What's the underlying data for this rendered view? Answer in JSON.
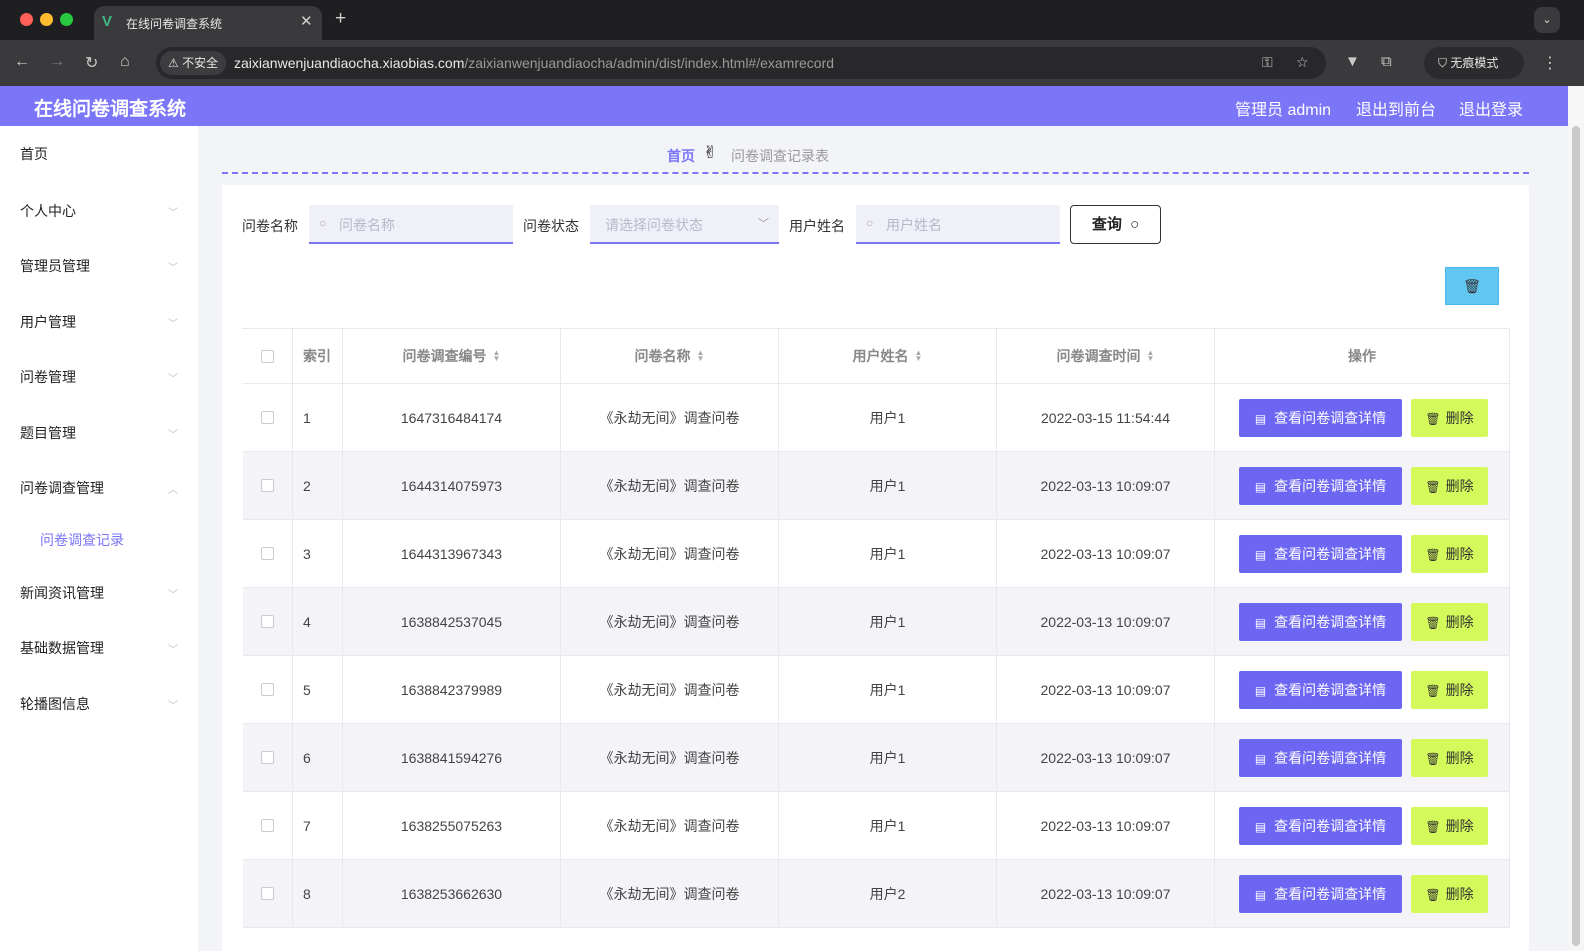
{
  "browser": {
    "tab_title": "在线问卷调查系统",
    "insecure_label": "不安全",
    "url_host": "zaixianwenjuandiaocha.xiaobias.com",
    "url_path": "/zaixianwenjuandiaocha/admin/dist/index.html#/examrecord",
    "incognito_label": "无痕模式"
  },
  "header": {
    "title": "在线问卷调查系统",
    "admin_label": "管理员 admin",
    "front_link": "退出到前台",
    "logout_link": "退出登录"
  },
  "sidebar": {
    "items": [
      {
        "label": "首页"
      },
      {
        "label": "个人中心"
      },
      {
        "label": "管理员管理"
      },
      {
        "label": "用户管理"
      },
      {
        "label": "问卷管理"
      },
      {
        "label": "题目管理"
      },
      {
        "label": "问卷调查管理"
      },
      {
        "label": "问卷调查记录"
      },
      {
        "label": "新闻资讯管理"
      },
      {
        "label": "基础数据管理"
      },
      {
        "label": "轮播图信息"
      }
    ]
  },
  "breadcrumb": {
    "home": "首页",
    "separator": "✌",
    "current": "问卷调查记录表"
  },
  "filters": {
    "name_label": "问卷名称",
    "name_placeholder": "问卷名称",
    "status_label": "问卷状态",
    "status_placeholder": "请选择问卷状态",
    "user_label": "用户姓名",
    "user_placeholder": "用户姓名",
    "query_button": "查询"
  },
  "table": {
    "headers": {
      "index": "索引",
      "code": "问卷调查编号",
      "name": "问卷名称",
      "user": "用户姓名",
      "time": "问卷调查时间",
      "ops": "操作"
    },
    "detail_button": "查看问卷调查详情",
    "delete_button": "删除",
    "rows": [
      {
        "index": "1",
        "code": "1647316484174",
        "name": "《永劫无间》调查问卷",
        "user": "用户1",
        "time": "2022-03-15 11:54:44"
      },
      {
        "index": "2",
        "code": "1644314075973",
        "name": "《永劫无间》调查问卷",
        "user": "用户1",
        "time": "2022-03-13 10:09:07"
      },
      {
        "index": "3",
        "code": "1644313967343",
        "name": "《永劫无间》调查问卷",
        "user": "用户1",
        "time": "2022-03-13 10:09:07"
      },
      {
        "index": "4",
        "code": "1638842537045",
        "name": "《永劫无间》调查问卷",
        "user": "用户1",
        "time": "2022-03-13 10:09:07"
      },
      {
        "index": "5",
        "code": "1638842379989",
        "name": "《永劫无间》调查问卷",
        "user": "用户1",
        "time": "2022-03-13 10:09:07"
      },
      {
        "index": "6",
        "code": "1638841594276",
        "name": "《永劫无间》调查问卷",
        "user": "用户1",
        "time": "2022-03-13 10:09:07"
      },
      {
        "index": "7",
        "code": "1638255075263",
        "name": "《永劫无间》调查问卷",
        "user": "用户1",
        "time": "2022-03-13 10:09:07"
      },
      {
        "index": "8",
        "code": "1638253662630",
        "name": "《永劫无间》调查问卷",
        "user": "用户2",
        "time": "2022-03-13 10:09:07"
      }
    ]
  },
  "colors": {
    "accent": "#7b75f8",
    "detail_button": "#6c66f2",
    "delete_button": "#d4f95a",
    "bulk_delete": "#62c6f3"
  }
}
